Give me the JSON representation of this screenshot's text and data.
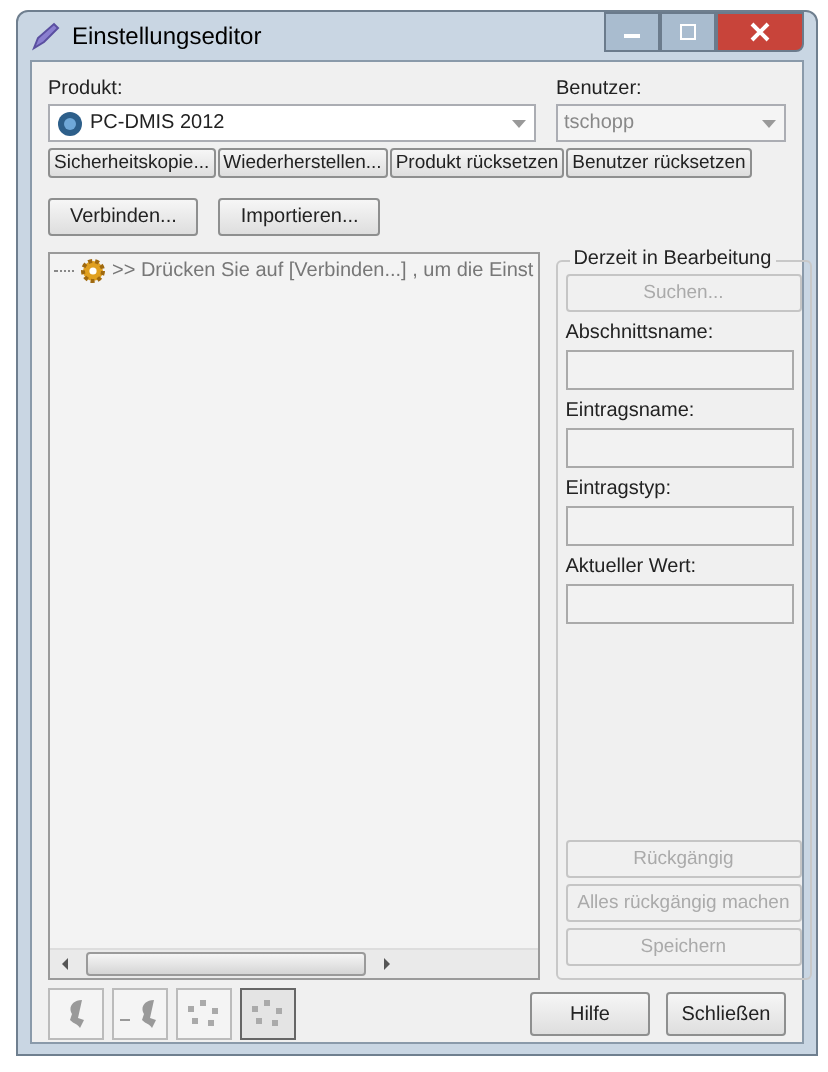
{
  "window": {
    "title": "Einstellungseditor"
  },
  "product": {
    "label": "Produkt:",
    "value": "PC-DMIS 2012",
    "disabled": false
  },
  "user": {
    "label": "Benutzer:",
    "value": "tschopp",
    "disabled": true
  },
  "backup_buttons": [
    {
      "label": "Sicherheitskopie..."
    },
    {
      "label": "Wiederherstellen..."
    },
    {
      "label": "Produkt rücksetzen"
    },
    {
      "label": "Benutzer rücksetzen"
    }
  ],
  "connect_buttons": [
    {
      "label": "Verbinden..."
    },
    {
      "label": "Importieren..."
    }
  ],
  "tree": {
    "items": [
      {
        "text": ">> Drücken Sie auf [Verbinden...] , um die Einst"
      }
    ]
  },
  "editing": {
    "title": "Derzeit in Bearbeitung",
    "search": {
      "label": "Suchen...",
      "disabled": true
    },
    "fields": [
      {
        "label": "Abschnittsname:"
      },
      {
        "label": "Eintragsname:"
      },
      {
        "label": "Eintragstyp:"
      },
      {
        "label": "Aktueller Wert:"
      }
    ],
    "actions": [
      {
        "label": "Rückgängig",
        "disabled": true
      },
      {
        "label": "Alles rückgängig machen",
        "disabled": true
      },
      {
        "label": "Speichern",
        "disabled": true
      }
    ]
  },
  "view_buttons": [
    {
      "kind": "single",
      "selected": false
    },
    {
      "kind": "arrow",
      "selected": false
    },
    {
      "kind": "multi",
      "selected": false
    },
    {
      "kind": "multi",
      "selected": true
    }
  ],
  "dialog_buttons": [
    {
      "label": "Hilfe"
    },
    {
      "label": "Schließen"
    }
  ]
}
